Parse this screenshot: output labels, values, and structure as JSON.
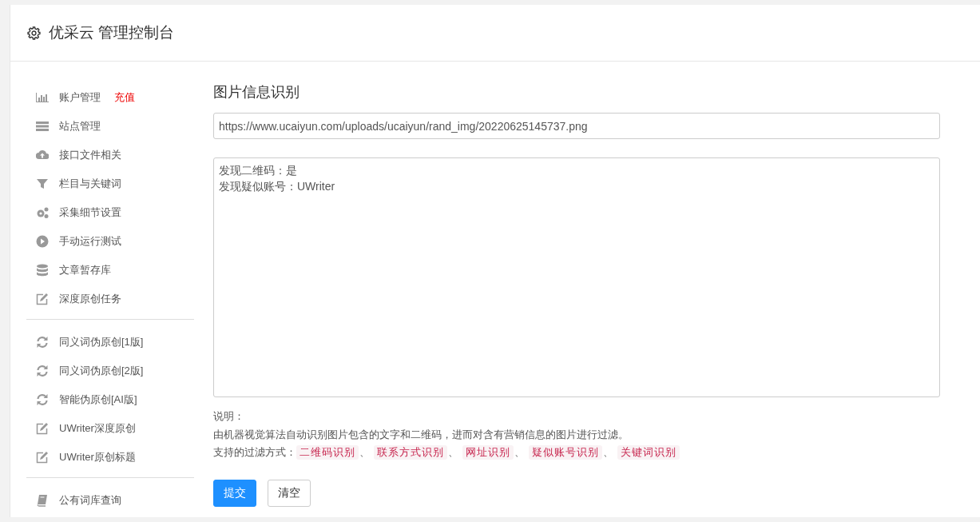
{
  "header": {
    "title": "优采云 管理控制台"
  },
  "sidebar": {
    "groups": [
      [
        {
          "label": "账户管理",
          "badge": "充值"
        },
        {
          "label": "站点管理"
        },
        {
          "label": "接口文件相关"
        },
        {
          "label": "栏目与关键词"
        },
        {
          "label": "采集细节设置"
        },
        {
          "label": "手动运行测试"
        },
        {
          "label": "文章暂存库"
        },
        {
          "label": "深度原创任务"
        }
      ],
      [
        {
          "label": "同义词伪原创[1版]"
        },
        {
          "label": "同义词伪原创[2版]"
        },
        {
          "label": "智能伪原创[AI版]"
        },
        {
          "label": "UWriter深度原创"
        },
        {
          "label": "UWriter原创标题"
        }
      ],
      [
        {
          "label": "公有词库查询"
        }
      ]
    ]
  },
  "panel": {
    "title": "图片信息识别",
    "url_field": {
      "value": "https://www.ucaiyun.com/uploads/ucaiyun/rand_img/20220625145737.png"
    },
    "result_field": {
      "lines": [
        "发现二维码：是",
        "发现疑似账号：UWriter"
      ]
    },
    "notes": {
      "heading": "说明：",
      "description": "由机器视觉算法自动识别图片包含的文字和二维码，进而对含有营销信息的图片进行过滤。",
      "methods_label": "支持的过滤方式：",
      "methods": [
        "二维码识别",
        "联系方式识别",
        "网址识别",
        "疑似账号识别",
        "关键词识别"
      ],
      "separator": "、"
    },
    "buttons": [
      {
        "label": "提交",
        "kind": "primary"
      },
      {
        "label": "清空",
        "kind": "default"
      }
    ]
  }
}
